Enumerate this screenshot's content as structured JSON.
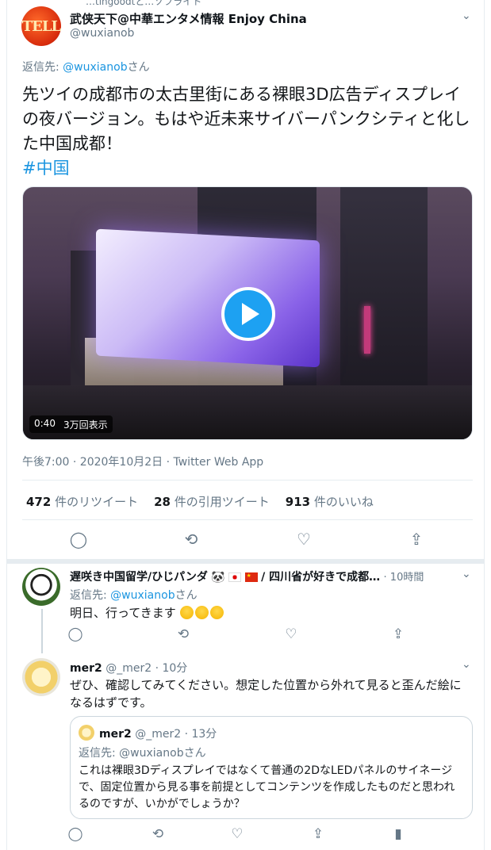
{
  "top_cut": "…tingoodtと…ソフライト",
  "main_tweet": {
    "name": "武侠天下@中華エンタメ情報 Enjoy China",
    "handle": "@wuxianob",
    "avatar_text": "TELL",
    "reply_to_prefix": "返信先: ",
    "reply_to_handle": "@wuxianob",
    "reply_to_suffix": "さん",
    "text": "先ツイの成都市の太古里街にある裸眼3D広告ディスプレイの夜バージョン。もはや近未来サイバーパンクシティと化した中国成都！",
    "hashtag": "#中国",
    "video": {
      "duration": "0:40",
      "views": "3万回表示"
    },
    "timestamp": "午後7:00 · 2020年10月2日 · Twitter Web App",
    "stats": [
      {
        "count": "472",
        "label": "件のリツイート"
      },
      {
        "count": "28",
        "label": "件の引用ツイート"
      },
      {
        "count": "913",
        "label": "件のいいね"
      }
    ],
    "actions": {
      "reply": "◯",
      "retweet": "⟲",
      "like": "♡",
      "share": "⇪"
    }
  },
  "reply1": {
    "name": "遅咲き中国留学/ひじパンダ",
    "name_suffix": "/ 四川省が好きで成都…",
    "time": "· 10時間",
    "reply_to_prefix": "返信先: ",
    "reply_to_handle": "@wuxianob",
    "reply_to_suffix": "さん",
    "text": "明日、行ってきます"
  },
  "reply2": {
    "name": "mer2",
    "handle": "@_mer2",
    "time": "· 10分",
    "text": "ぜひ、確認してみてください。想定した位置から外れて見ると歪んだ絵になるはずです。",
    "quote": {
      "name": "mer2",
      "handle": "@_mer2",
      "time": "· 13分",
      "reply_to_prefix": "返信先: ",
      "reply_to_handle": "@wuxianob",
      "reply_to_suffix": "さん",
      "text": "これは裸眼3Dディスプレイではなくて普通の2DなLEDパネルのサイネージで、固定位置から見る事を前提としてコンテンツを作成したものだと思われるのですが、いかがでしょうか？"
    }
  }
}
